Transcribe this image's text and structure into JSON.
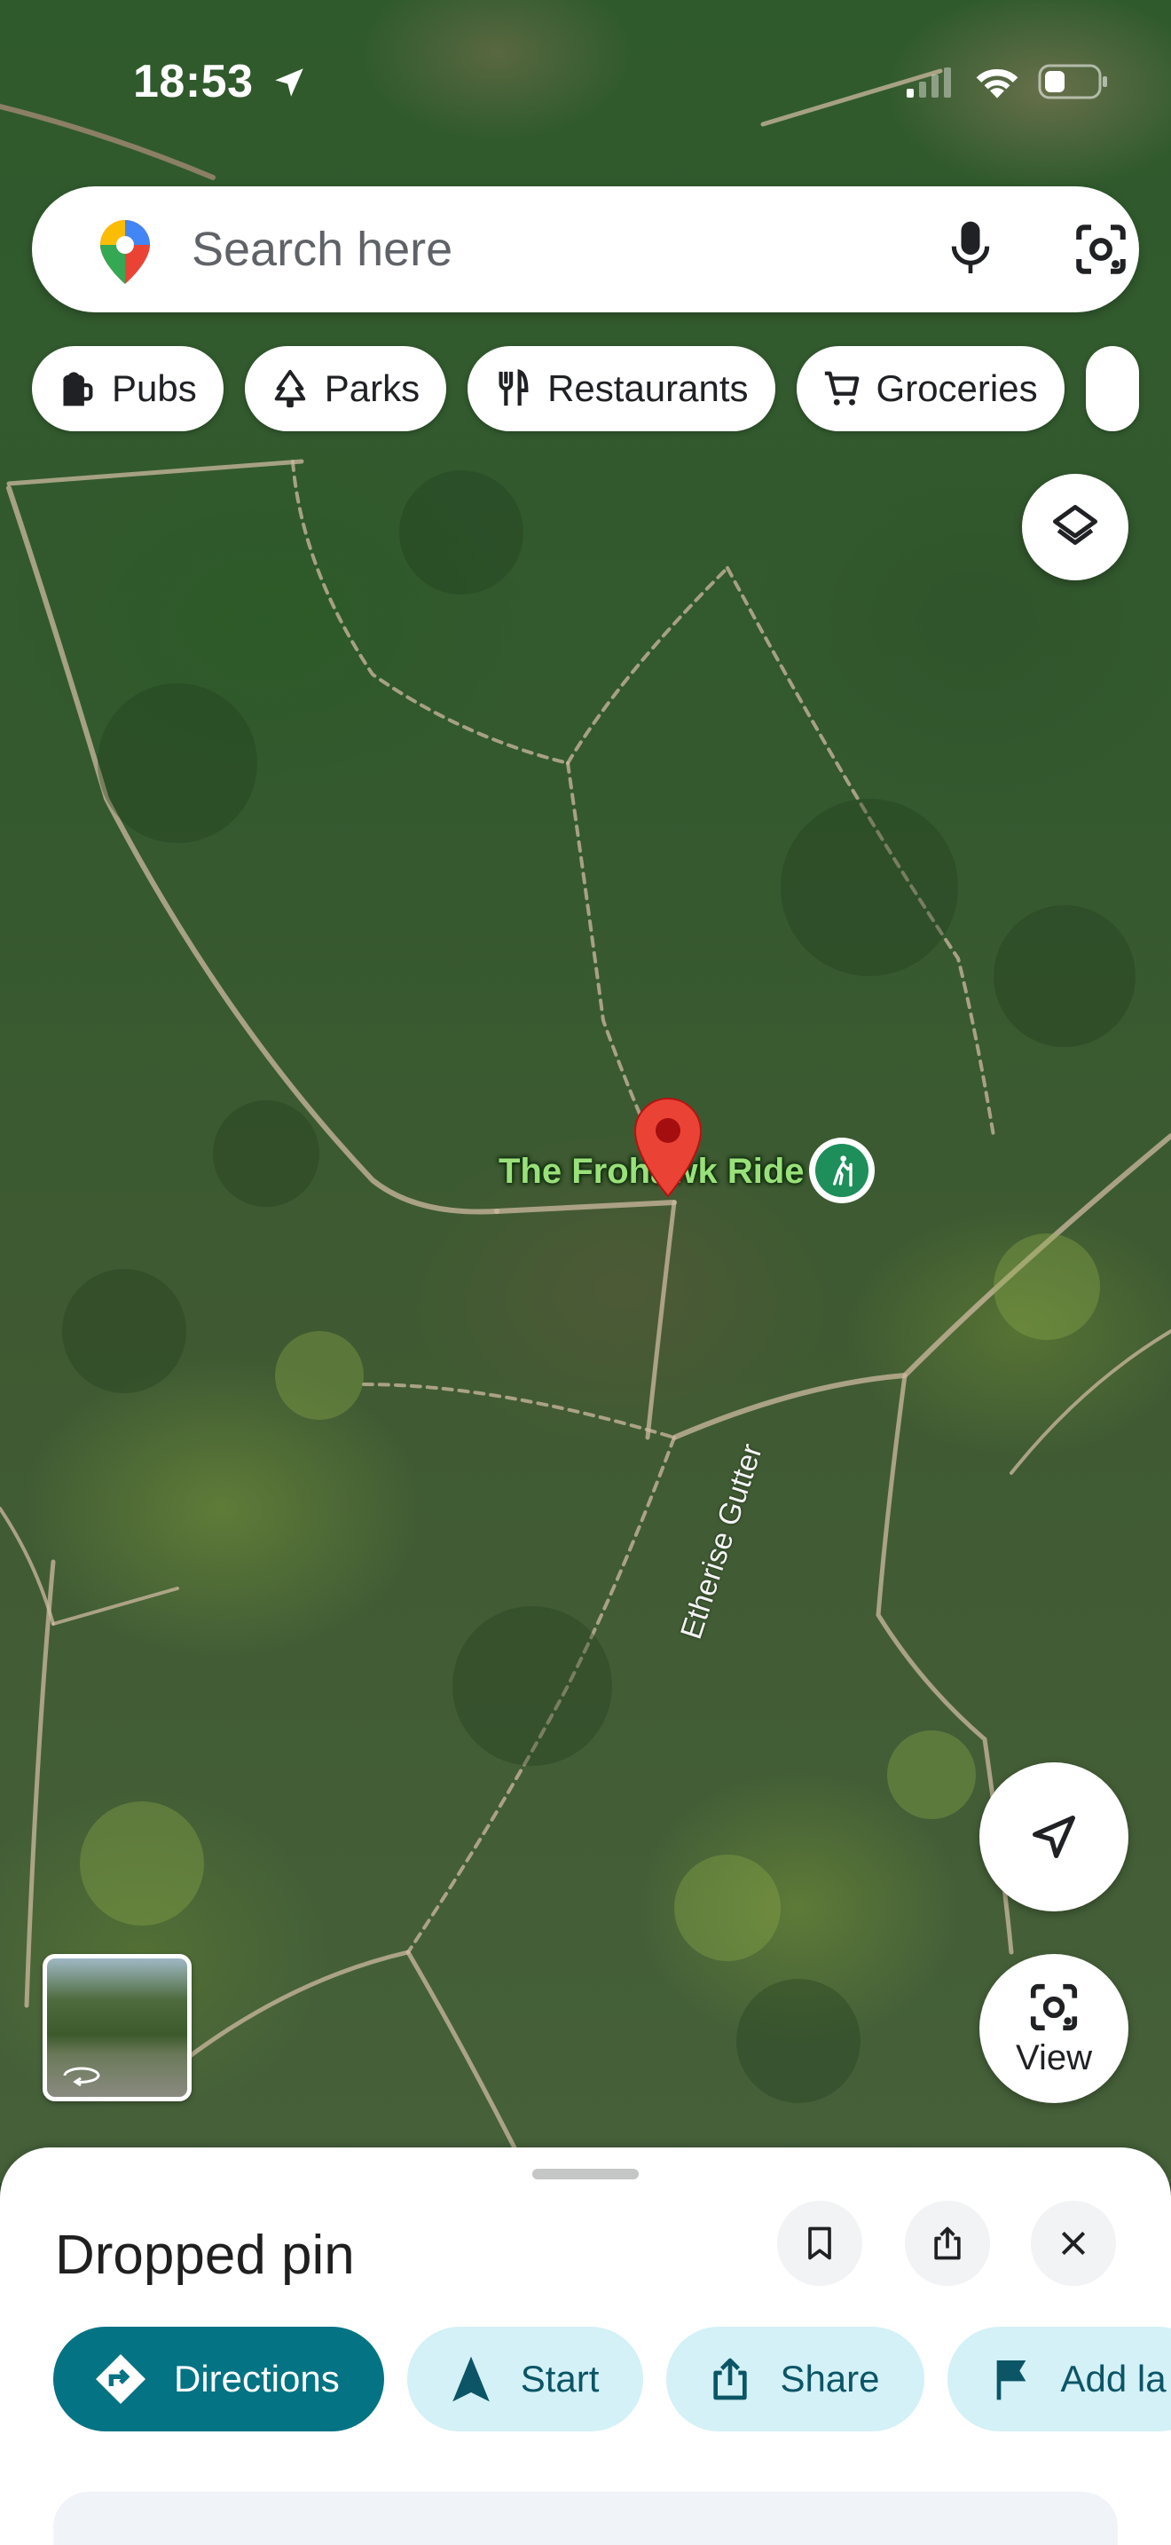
{
  "status_bar": {
    "time": "18:53",
    "icons": [
      "location-arrow-icon",
      "signal-icon",
      "wifi-icon",
      "battery-icon"
    ]
  },
  "search": {
    "placeholder": "Search here",
    "icons": [
      "maps-pin-icon",
      "mic-icon",
      "lens-icon"
    ]
  },
  "chips": [
    {
      "label": "Pubs",
      "icon": "beer-icon"
    },
    {
      "label": "Parks",
      "icon": "tree-icon"
    },
    {
      "label": "Restaurants",
      "icon": "fork-knife-icon"
    },
    {
      "label": "Groceries",
      "icon": "cart-icon"
    }
  ],
  "map": {
    "place_label": "The Frohawk Ride",
    "street_label": "Etherise Gutter",
    "view_button_label": "View"
  },
  "sheet": {
    "title": "Dropped pin",
    "actions": [
      {
        "label": "Directions",
        "icon": "directions-icon",
        "primary": true
      },
      {
        "label": "Start",
        "icon": "navigation-arrow-icon"
      },
      {
        "label": "Share",
        "icon": "share-icon"
      },
      {
        "label": "Add la",
        "icon": "flag-icon"
      }
    ]
  },
  "colors": {
    "accent": "#047384",
    "chip_light": "#d3f1f6",
    "pin_red": "#ea4335",
    "poi_green": "#1e8e5a"
  }
}
